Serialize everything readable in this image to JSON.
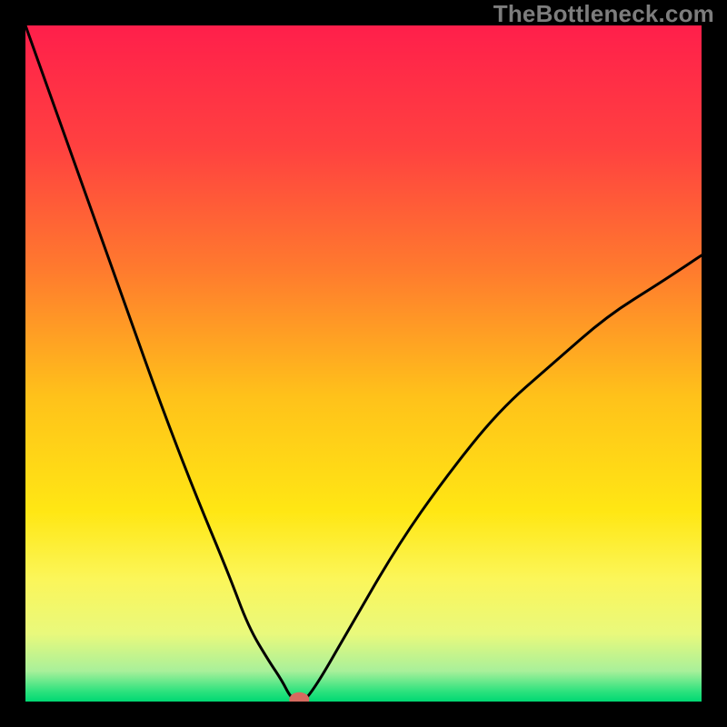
{
  "watermark": "TheBottleneck.com",
  "chart_data": {
    "type": "line",
    "title": "",
    "xlabel": "",
    "ylabel": "",
    "xlim": [
      0,
      100
    ],
    "ylim": [
      0,
      100
    ],
    "series": [
      {
        "name": "bottleneck-curve",
        "x": [
          0,
          5,
          10,
          15,
          20,
          25,
          30,
          33,
          36,
          38,
          39,
          40,
          41,
          42,
          44,
          48,
          55,
          62,
          70,
          78,
          86,
          94,
          100
        ],
        "y": [
          100,
          86,
          72,
          58,
          44,
          31,
          19,
          11,
          6,
          3,
          1,
          0,
          0,
          1,
          4,
          11,
          23,
          33,
          43,
          50,
          57,
          62,
          66
        ]
      }
    ],
    "marker": {
      "x": 40.5,
      "y": 0.3,
      "color": "#d66a5f"
    },
    "gradient_stops": [
      {
        "offset": 0.0,
        "color": "#ff1f4b"
      },
      {
        "offset": 0.18,
        "color": "#ff4140"
      },
      {
        "offset": 0.36,
        "color": "#ff7a2e"
      },
      {
        "offset": 0.55,
        "color": "#ffc21a"
      },
      {
        "offset": 0.72,
        "color": "#ffe714"
      },
      {
        "offset": 0.82,
        "color": "#fbf65a"
      },
      {
        "offset": 0.9,
        "color": "#e9f97c"
      },
      {
        "offset": 0.955,
        "color": "#a8f09a"
      },
      {
        "offset": 0.985,
        "color": "#2de27e"
      },
      {
        "offset": 1.0,
        "color": "#00d873"
      }
    ]
  }
}
